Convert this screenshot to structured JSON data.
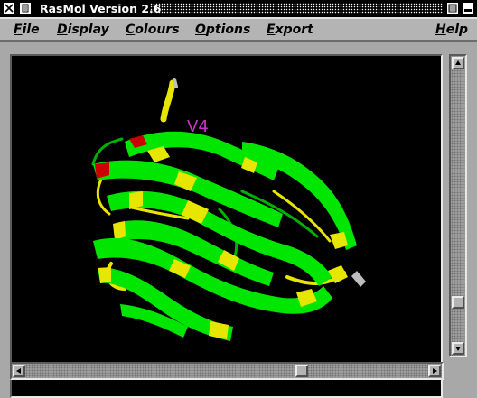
{
  "window": {
    "title": "RasMol Version 2.6",
    "close_icon": "close-x-icon",
    "menu_icon": "window-menu-icon",
    "maximize_icon": "maximize-icon",
    "minimize_icon": "minimize-icon"
  },
  "menubar": {
    "items": [
      {
        "label": "File",
        "underline": "F",
        "rest": "ile"
      },
      {
        "label": "Display",
        "underline": "D",
        "rest": "isplay"
      },
      {
        "label": "Colours",
        "underline": "C",
        "rest": "olours"
      },
      {
        "label": "Options",
        "underline": "O",
        "rest": "ptions"
      },
      {
        "label": "Export",
        "underline": "E",
        "rest": "xport"
      },
      {
        "label": "Help",
        "underline": "H",
        "rest": "elp"
      }
    ]
  },
  "viewer": {
    "background": "#000000",
    "label": "V4",
    "label_color": "#c832c8",
    "colors": {
      "strand": "#00e600",
      "turn": "#e6e600",
      "helix": "#cc0000",
      "coil": "#bebebe"
    }
  },
  "scrollbars": {
    "vertical": {
      "up_icon": "arrow-up-icon",
      "down_icon": "arrow-down-icon",
      "position": 0.88
    },
    "horizontal": {
      "left_icon": "arrow-left-icon",
      "right_icon": "arrow-right-icon",
      "position": 0.7
    }
  }
}
